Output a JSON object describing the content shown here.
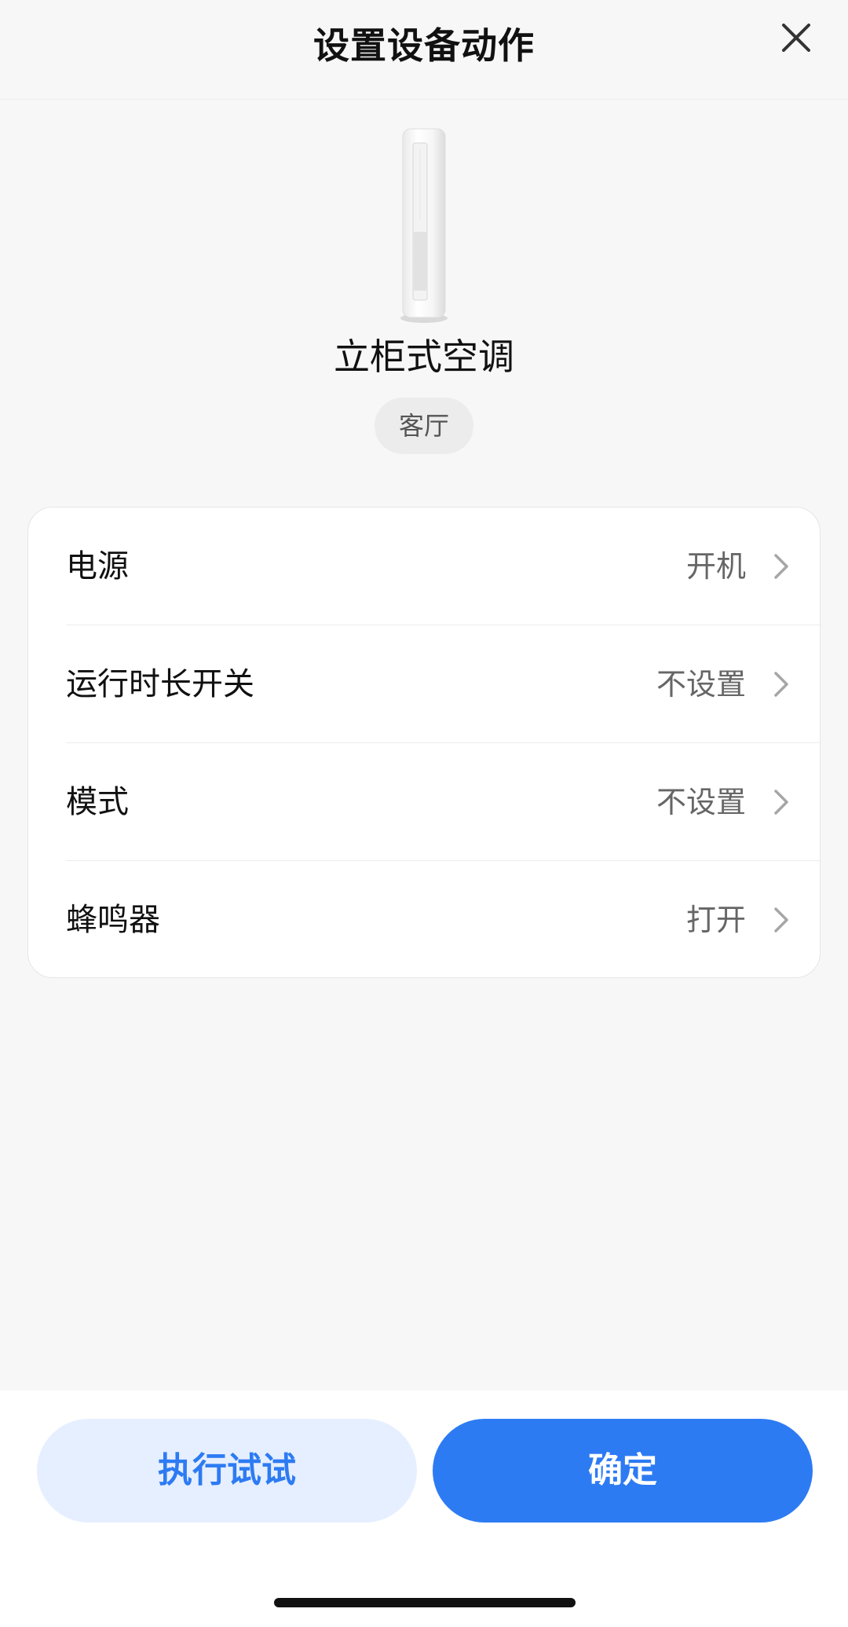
{
  "header": {
    "title": "设置设备动作",
    "close_icon": "close-icon"
  },
  "device": {
    "image_icon": "floor-air-conditioner",
    "name": "立柜式空调",
    "room": "客厅"
  },
  "settings": [
    {
      "label": "电源",
      "value": "开机"
    },
    {
      "label": "运行时长开关",
      "value": "不设置"
    },
    {
      "label": "模式",
      "value": "不设置"
    },
    {
      "label": "蜂鸣器",
      "value": "打开"
    }
  ],
  "footer": {
    "try_label": "执行试试",
    "confirm_label": "确定"
  },
  "colors": {
    "accent": "#2d7bf3",
    "accent_light": "#e6efff",
    "background": "#f7f7f7"
  }
}
